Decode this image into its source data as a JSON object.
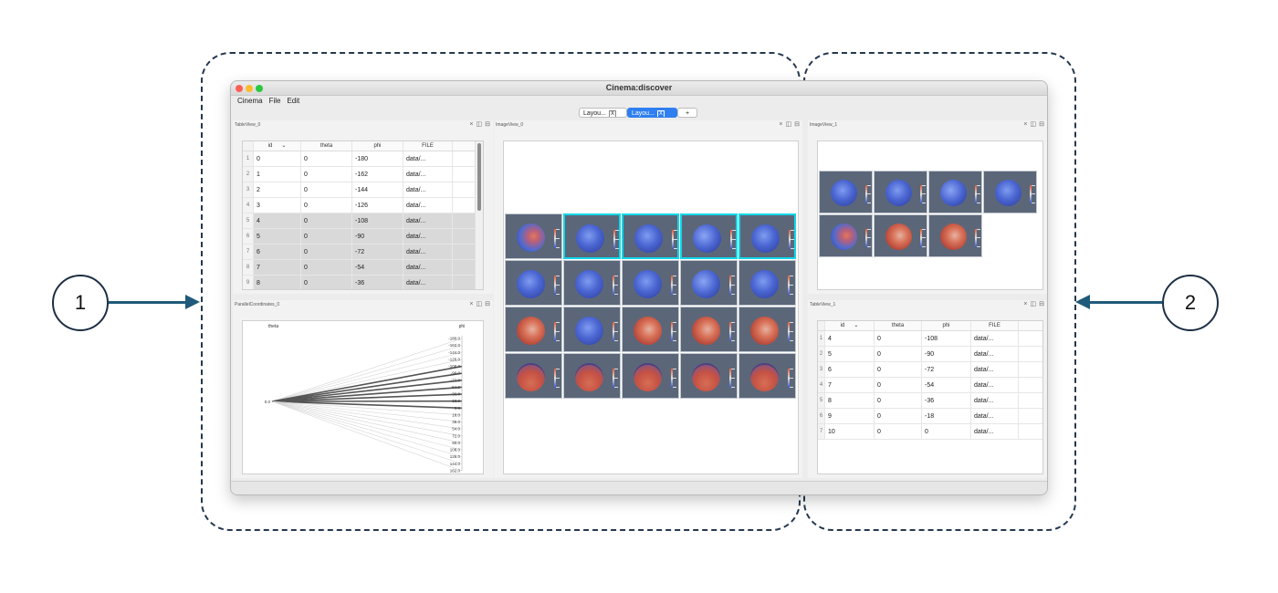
{
  "callouts": {
    "left": "1",
    "right": "2"
  },
  "window": {
    "title": "Cinema:discover",
    "menu": [
      "Cinema",
      "File",
      "Edit"
    ],
    "tabs": [
      {
        "label": "Layou...",
        "close": "X",
        "active": false
      },
      {
        "label": "Layou...",
        "close": "X",
        "active": true
      }
    ],
    "add_tab": "+"
  },
  "icons": {
    "close": "×",
    "split_vertical": "◫",
    "split_horizontal": "⊟"
  },
  "panes": {
    "table_view_0": {
      "title": "TableView_0",
      "columns": [
        "id",
        "theta",
        "phi",
        "FILE"
      ],
      "sort_indicator": "⌄",
      "rows": [
        {
          "num": "1",
          "id": "0",
          "theta": "0",
          "phi": "-180",
          "file": "data/...",
          "selected": false
        },
        {
          "num": "2",
          "id": "1",
          "theta": "0",
          "phi": "-162",
          "file": "data/...",
          "selected": false
        },
        {
          "num": "3",
          "id": "2",
          "theta": "0",
          "phi": "-144",
          "file": "data/...",
          "selected": false
        },
        {
          "num": "4",
          "id": "3",
          "theta": "0",
          "phi": "-126",
          "file": "data/...",
          "selected": false
        },
        {
          "num": "5",
          "id": "4",
          "theta": "0",
          "phi": "-108",
          "file": "data/...",
          "selected": true
        },
        {
          "num": "6",
          "id": "5",
          "theta": "0",
          "phi": "-90",
          "file": "data/...",
          "selected": true
        },
        {
          "num": "7",
          "id": "6",
          "theta": "0",
          "phi": "-72",
          "file": "data/...",
          "selected": true
        },
        {
          "num": "8",
          "id": "7",
          "theta": "0",
          "phi": "-54",
          "file": "data/...",
          "selected": true
        },
        {
          "num": "9",
          "id": "8",
          "theta": "0",
          "phi": "-36",
          "file": "data/...",
          "selected": true
        }
      ]
    },
    "parallel_coordinates_0": {
      "title": "ParallelCoordinates_0",
      "axes": [
        "theta",
        "phi"
      ],
      "theta_tick": "0.0",
      "phi_ticks": [
        "-180.0",
        "-162.0",
        "-144.0",
        "-126.0",
        "-108.0",
        "-90.0",
        "-72.0",
        "-54.0",
        "-36.0",
        "-18.0",
        "0.0",
        "18.0",
        "36.0",
        "54.0",
        "72.0",
        "90.0",
        "108.0",
        "126.0",
        "144.0",
        "162.0"
      ],
      "highlighted_phi": [
        -108,
        -90,
        -72,
        -54,
        -36,
        -18,
        0
      ]
    },
    "image_view_0": {
      "title": "ImageView_0",
      "rows": 4,
      "cols": 5,
      "selected_indices": [
        1,
        2,
        3,
        4
      ]
    },
    "image_view_1": {
      "title": "ImageView_1",
      "count": 7
    },
    "table_view_1": {
      "title": "TableView_1",
      "columns": [
        "id",
        "theta",
        "phi",
        "FILE"
      ],
      "sort_indicator": "⌄",
      "rows": [
        {
          "num": "1",
          "id": "4",
          "theta": "0",
          "phi": "-108",
          "file": "data/..."
        },
        {
          "num": "2",
          "id": "5",
          "theta": "0",
          "phi": "-90",
          "file": "data/..."
        },
        {
          "num": "3",
          "id": "6",
          "theta": "0",
          "phi": "-72",
          "file": "data/..."
        },
        {
          "num": "4",
          "id": "7",
          "theta": "0",
          "phi": "-54",
          "file": "data/..."
        },
        {
          "num": "5",
          "id": "8",
          "theta": "0",
          "phi": "-36",
          "file": "data/..."
        },
        {
          "num": "6",
          "id": "9",
          "theta": "0",
          "phi": "-18",
          "file": "data/..."
        },
        {
          "num": "7",
          "id": "10",
          "theta": "0",
          "phi": "0",
          "file": "data/..."
        }
      ]
    }
  },
  "colors": {
    "accent": "#2f7ff0",
    "selection_highlight": "#11d6e8",
    "traffic_close": "#fe5f57",
    "traffic_min": "#febc2e",
    "traffic_max": "#28c840",
    "thumb_bg": "#5b6779",
    "callout_arrow": "#1f5a7a"
  }
}
